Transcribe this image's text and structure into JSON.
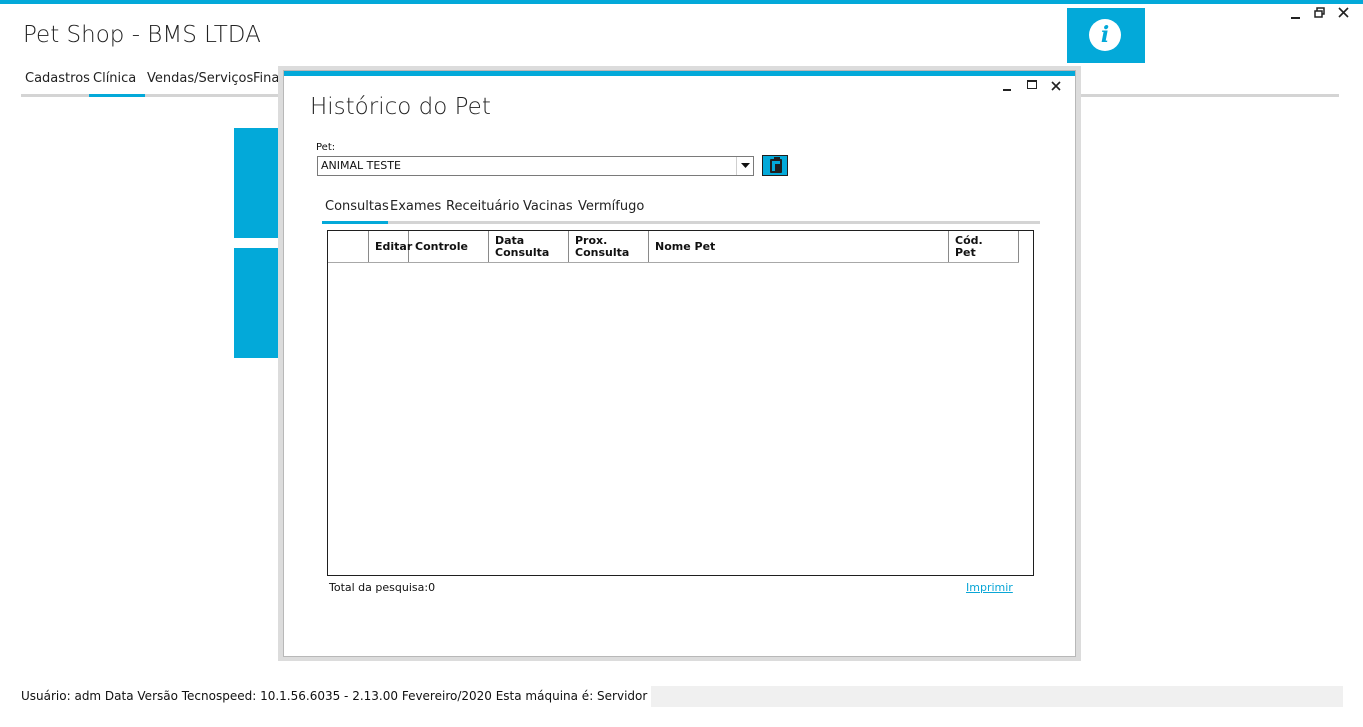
{
  "app": {
    "title": "Pet Shop - BMS LTDA",
    "info_icon": "i",
    "window_controls": {
      "minimize": "‗",
      "restore": "🗗",
      "close": "✕"
    }
  },
  "menu": {
    "items": [
      {
        "label": "Cadastros"
      },
      {
        "label": "Clínica"
      },
      {
        "label": "Vendas/Serviços"
      },
      {
        "label": "Finan"
      }
    ],
    "active": "Clínica"
  },
  "statusbar": {
    "text": "Usuário: adm  Data  Versão Tecnospeed:  10.1.56.6035 - 2.13.00 Fevereiro/2020  Esta máquina é: Servidor"
  },
  "dialog": {
    "title": "Histórico do Pet",
    "controls": {
      "minimize": "_",
      "maximize": "☐",
      "close": "✕"
    },
    "pet_label": "Pet:",
    "pet_value": "ANIMAL TESTE",
    "tabs": [
      {
        "label": "Consultas"
      },
      {
        "label": "Exames"
      },
      {
        "label": "Receituário"
      },
      {
        "label": "Vacinas"
      },
      {
        "label": "Vermífugo"
      }
    ],
    "active_tab": "Consultas",
    "grid": {
      "columns": [
        {
          "label": ""
        },
        {
          "label": "Editar"
        },
        {
          "label": "Controle"
        },
        {
          "label": "Data\nConsulta"
        },
        {
          "label": "Prox.\nConsulta"
        },
        {
          "label": "Nome Pet"
        },
        {
          "label": "Cód.\nPet"
        }
      ],
      "rows": []
    },
    "total_label": "Total da pesquisa:",
    "total_value": "0",
    "print_label": "Imprimir"
  }
}
